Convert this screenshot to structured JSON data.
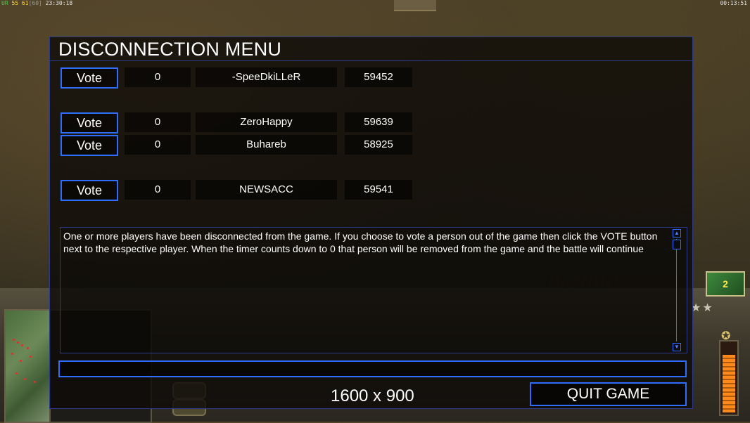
{
  "hud": {
    "ur_label": "UR",
    "fps_values": "55 61",
    "fps_cap": "[60]",
    "clock": "23:30:18",
    "game_timer": "00:13:51"
  },
  "menu": {
    "title": "DISCONNECTION MENU",
    "vote_label": "Vote",
    "players": [
      {
        "votes": "0",
        "name": "-SpeeDkiLLeR",
        "ping": "59452"
      },
      {
        "votes": "0",
        "name": "ZeroHappy",
        "ping": "59639"
      },
      {
        "votes": "0",
        "name": "Buhareb",
        "ping": "58925"
      },
      {
        "votes": "0",
        "name": "NEWSACC",
        "ping": "59541"
      }
    ],
    "message": "One or more players have been disconnected from the game. If you choose to vote a person out of the game then click the VOTE button next to the respective player. When the timer counts down to 0 that person will be removed from the game and the battle will continue",
    "chat_input_value": "",
    "quit_label": "QUIT GAME"
  },
  "overlay": {
    "resolution": "1600 x 900"
  },
  "colors": {
    "accent_border": "#2f6dff",
    "panel_border": "#2c3a8c"
  },
  "icons": {
    "scroll_up": "scroll-up-arrow-icon",
    "scroll_down": "scroll-down-arrow-icon",
    "general_power": "general-power-icon",
    "rank": "rank-stars-icon"
  }
}
